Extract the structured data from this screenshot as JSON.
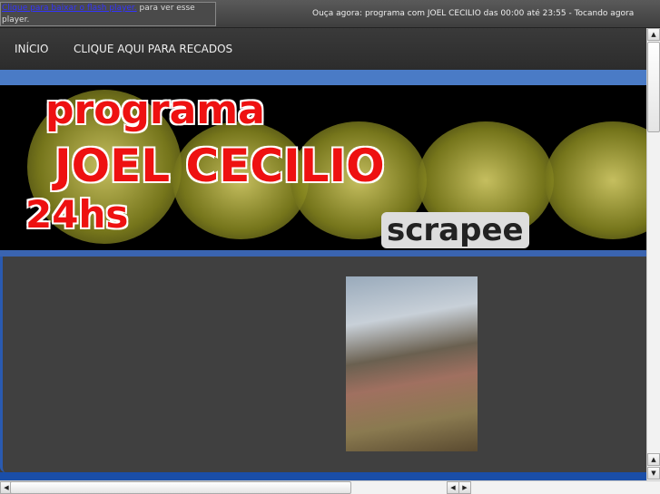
{
  "flash_notice": {
    "link": "Clique para baixar o flash player.",
    "text": " para ver esse player."
  },
  "now_playing": "Ouça agora: programa com JOEL CECILIO das 00:00 até 23:55 - Tocando agora",
  "nav": {
    "items": [
      {
        "label": "INÍCIO"
      },
      {
        "label": "CLIQUE AQUI PARA RECADOS"
      }
    ]
  },
  "banner": {
    "line1": "programa",
    "line2": "JOEL CECILIO",
    "line3": "24hs",
    "watermark": "scrapee"
  },
  "colors": {
    "blue_strip": "#4a7bc6",
    "dark_blue": "#1a4ea8",
    "panel": "#404040"
  }
}
